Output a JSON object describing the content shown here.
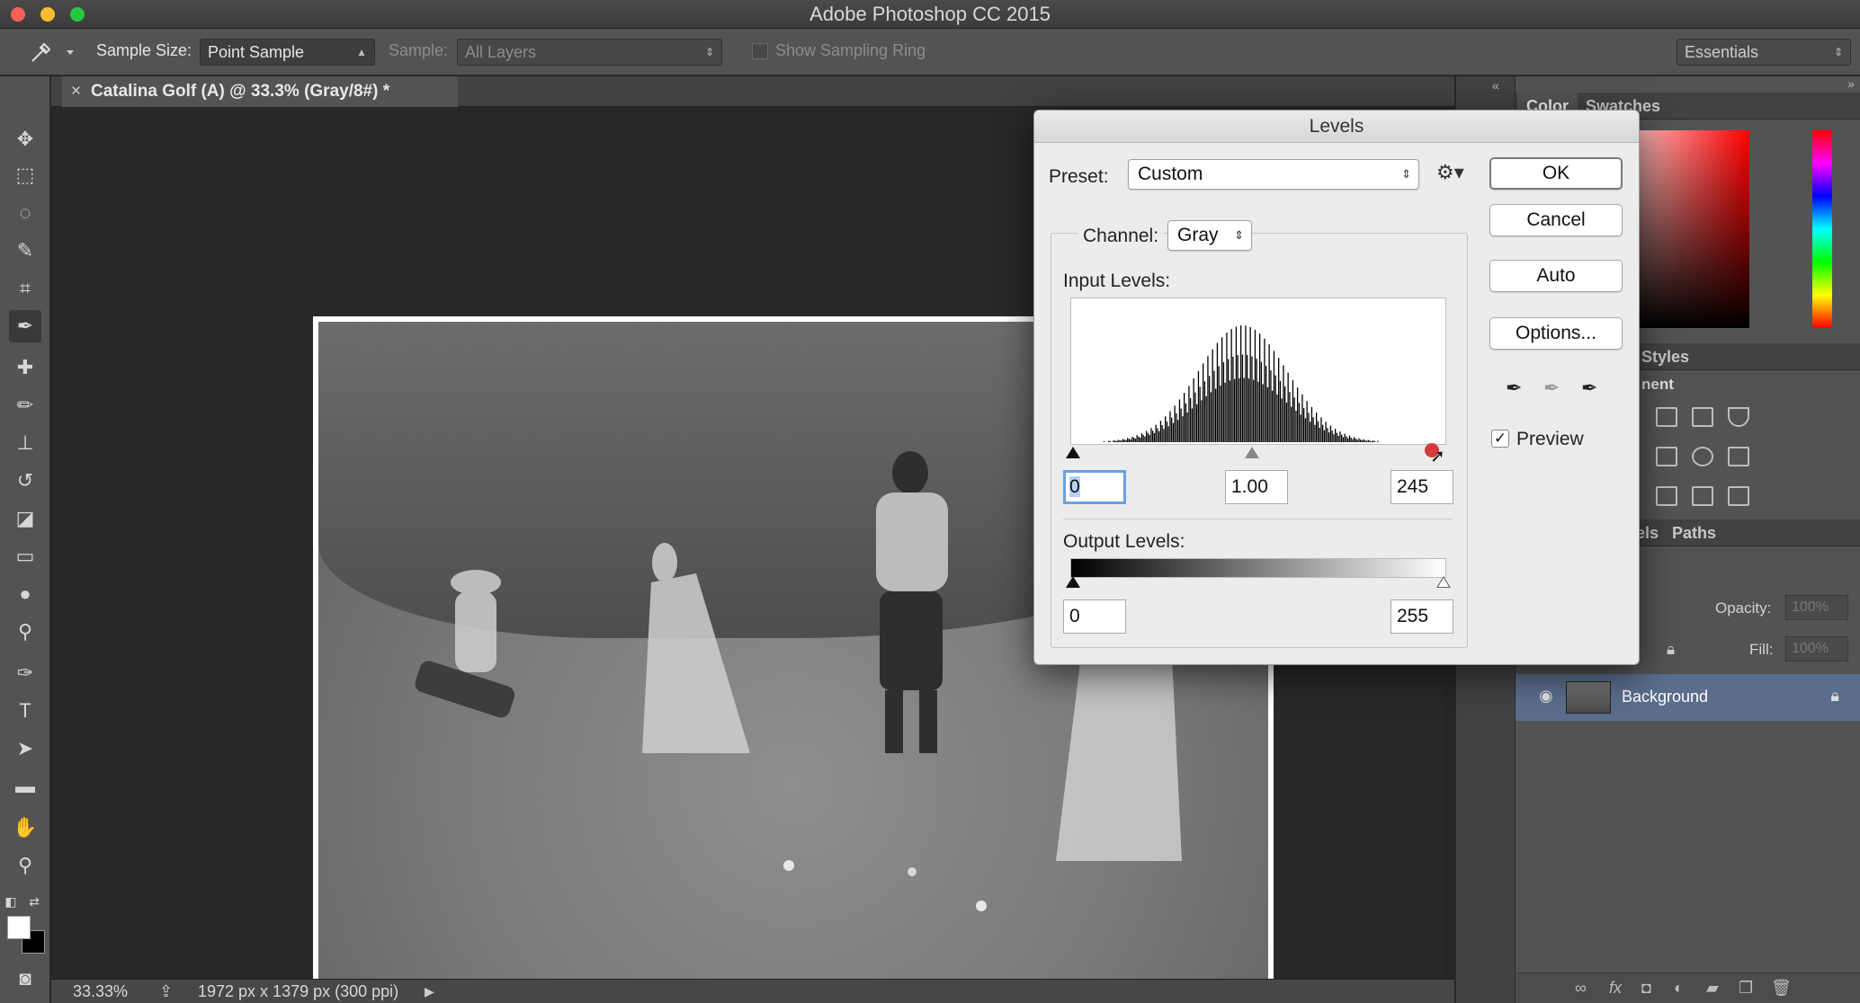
{
  "app": {
    "title": "Adobe Photoshop CC 2015"
  },
  "options_bar": {
    "sample_size_label": "Sample Size:",
    "sample_size_value": "Point Sample",
    "sample_label": "Sample:",
    "sample_value": "All Layers",
    "show_sampling_ring": "Show Sampling Ring",
    "workspace": "Essentials"
  },
  "document": {
    "tab_title": "Catalina Golf (A) @ 33.3% (Gray/8#) *",
    "close_glyph": "×"
  },
  "status": {
    "zoom": "33.33%",
    "doc_info": "1972 px x 1379 px (300 ppi)"
  },
  "panels": {
    "color_tab": "Color",
    "swatches_tab": "Swatches",
    "styles_tab": "Styles",
    "adjustments_label": "nent",
    "channels_tab": "els",
    "paths_tab": "Paths",
    "opacity_label": "Opacity:",
    "opacity_value": "100%",
    "fill_label": "Fill:",
    "fill_value": "100%",
    "layer_name": "Background"
  },
  "levels": {
    "title": "Levels",
    "preset_label": "Preset:",
    "preset_value": "Custom",
    "channel_label": "Channel:",
    "channel_value": "Gray",
    "input_levels_label": "Input Levels:",
    "input_black": "0",
    "input_gamma": "1.00",
    "input_white": "245",
    "output_levels_label": "Output Levels:",
    "output_black": "0",
    "output_white": "255",
    "ok": "OK",
    "cancel": "Cancel",
    "auto": "Auto",
    "options": "Options...",
    "preview": "Preview",
    "preview_checked": true
  },
  "chart_data": {
    "type": "bar",
    "title": "",
    "xlim": [
      0,
      255
    ],
    "values": []
  }
}
